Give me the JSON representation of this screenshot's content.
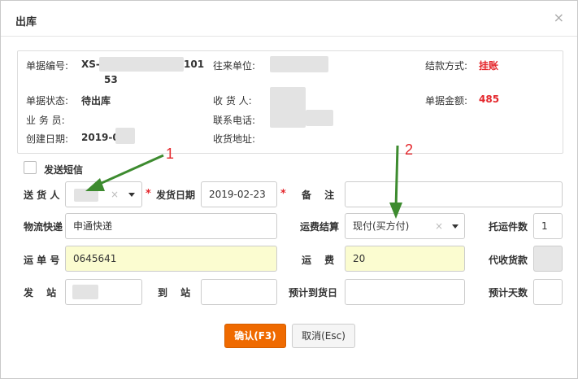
{
  "dialog": {
    "title": "出库",
    "close_glyph": "×"
  },
  "info": {
    "order_no_label": "单据编号:",
    "order_no_value": "XS-",
    "order_no_mid": "101",
    "order_no_line2": "53",
    "partner_label": "往来单位:",
    "settle_method_label": "结款方式:",
    "settle_method_value": "挂账",
    "status_label": "单据状态:",
    "status_value": "待出库",
    "receiver_label": "收 货 人:",
    "amount_label": "单据金额:",
    "amount_value": "485",
    "salesman_label": "业 务 员:",
    "phone_label": "联系电话:",
    "created_label": "创建日期:",
    "created_value": "2019-0",
    "address_label": "收货地址:"
  },
  "form": {
    "sms_label": "发送短信",
    "sender_label": "送 货 人",
    "ship_date_label": "发货日期",
    "ship_date_value": "2019-02-23",
    "remark_label": "备　 注",
    "logistics_label": "物流快递",
    "logistics_value": "申通快递",
    "freight_settle_label": "运费结算",
    "freight_settle_value": "现付(买方付)",
    "consign_count_label": "托运件数",
    "consign_count_value": "1",
    "waybill_label": "运 单 号",
    "waybill_value": "0645641",
    "freight_label": "运　 费",
    "freight_value": "20",
    "cod_label": "代收货款",
    "from_station_label": "发　 站",
    "to_station_label": "到　 站",
    "eta_label": "预计到货日",
    "est_days_label": "预计天数",
    "required_mark": "*",
    "clear_glyph": "×"
  },
  "buttons": {
    "confirm": "确认(F3)",
    "cancel": "取消(Esc)"
  },
  "annotations": {
    "one": "1",
    "two": "2",
    "arrow_color": "#3d8b2f"
  }
}
